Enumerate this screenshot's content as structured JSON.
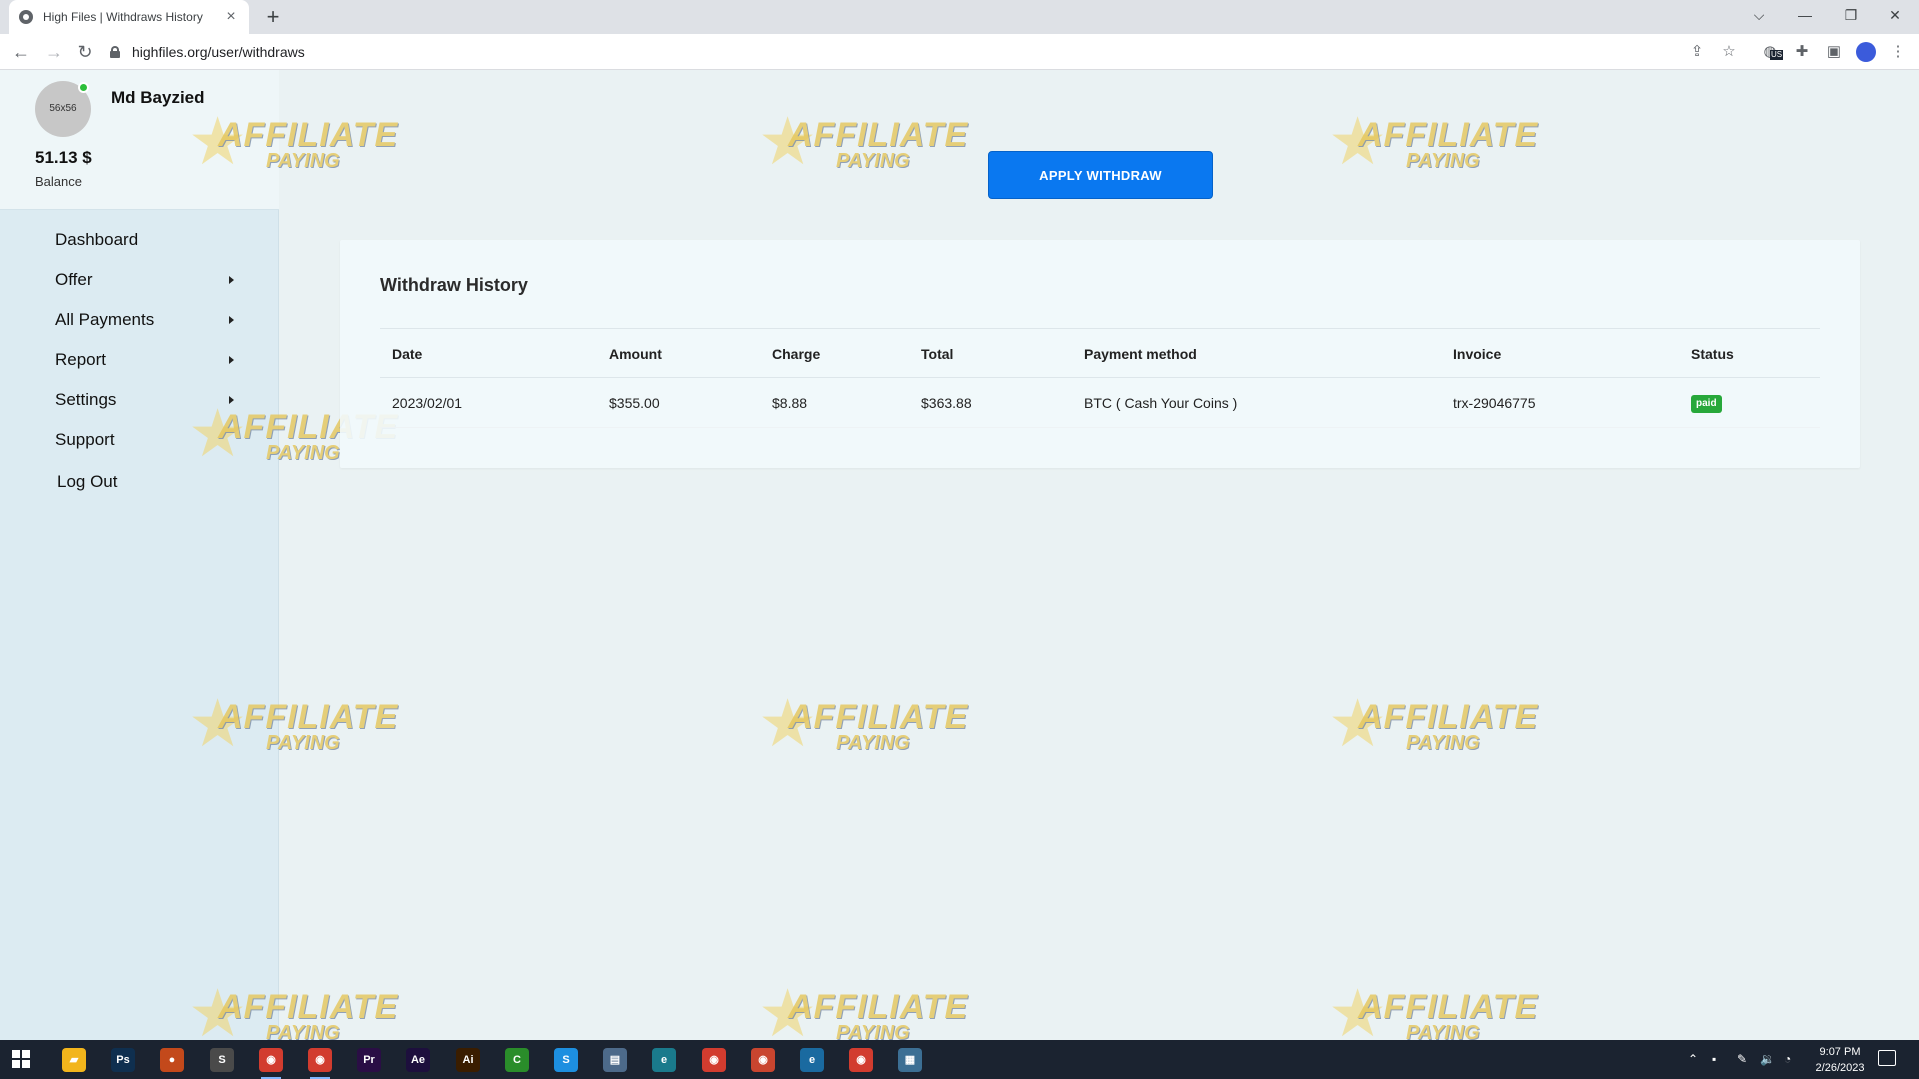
{
  "browser": {
    "tab_title": "High Files | Withdraws History",
    "tab_close": "×",
    "new_tab": "+",
    "url": "highfiles.org/user/withdraws",
    "window_controls": {
      "chevron": "⌵",
      "minimize": "—",
      "restore": "❐",
      "close": "✕"
    },
    "ext_badge": "US"
  },
  "watermark": {
    "text_top": "AFFILIATE",
    "text_bottom": "PAYING"
  },
  "sidebar": {
    "avatar_placeholder": "56x56",
    "user_name": "Md Bayzied",
    "balance_amount": "51.13 $",
    "balance_label": "Balance",
    "menu": [
      {
        "label": "Dashboard",
        "has_submenu": false
      },
      {
        "label": "Offer",
        "has_submenu": true
      },
      {
        "label": "All Payments",
        "has_submenu": true
      },
      {
        "label": "Report",
        "has_submenu": true
      },
      {
        "label": "Settings",
        "has_submenu": true
      },
      {
        "label": "Support",
        "has_submenu": false
      },
      {
        "label": "Log Out",
        "has_submenu": false
      }
    ]
  },
  "main": {
    "apply_button": "APPLY WITHDRAW",
    "card_title": "Withdraw History",
    "table": {
      "headers": {
        "date": "Date",
        "amount": "Amount",
        "charge": "Charge",
        "total": "Total",
        "method": "Payment method",
        "invoice": "Invoice",
        "status": "Status"
      },
      "rows": [
        {
          "date": "2023/02/01",
          "amount": "$355.00",
          "charge": "$8.88",
          "total": "$363.88",
          "method": "BTC ( Cash Your Coins )",
          "invoice": "trx-29046775",
          "status": "paid"
        }
      ]
    }
  },
  "taskbar": {
    "apps": [
      {
        "name": "file-explorer",
        "label": "▰",
        "color": "#f2b51c"
      },
      {
        "name": "photoshop",
        "label": "Ps",
        "color": "#0f2f4f"
      },
      {
        "name": "app-3",
        "label": "●",
        "color": "#c3491b"
      },
      {
        "name": "sublime",
        "label": "S",
        "color": "#4a4a4a"
      },
      {
        "name": "chrome-1",
        "label": "◉",
        "color": "#d23c2f"
      },
      {
        "name": "chrome-2",
        "label": "◉",
        "color": "#d23c2f"
      },
      {
        "name": "premiere",
        "label": "Pr",
        "color": "#2a0e45"
      },
      {
        "name": "after-effects",
        "label": "Ae",
        "color": "#1d0f3d"
      },
      {
        "name": "illustrator",
        "label": "Ai",
        "color": "#3a1d00"
      },
      {
        "name": "camtasia",
        "label": "C",
        "color": "#2a8d2a"
      },
      {
        "name": "skype",
        "label": "S",
        "color": "#1d8fe0"
      },
      {
        "name": "notepad",
        "label": "▤",
        "color": "#4d6a8a"
      },
      {
        "name": "edge",
        "label": "e",
        "color": "#1a7a8c"
      },
      {
        "name": "chrome-3",
        "label": "◉",
        "color": "#d23c2f"
      },
      {
        "name": "chrome-4",
        "label": "◉",
        "color": "#c9452f"
      },
      {
        "name": "edge-2",
        "label": "e",
        "color": "#1a6aa0"
      },
      {
        "name": "chrome-5",
        "label": "◉",
        "color": "#d23c2f"
      },
      {
        "name": "app-18",
        "label": "▦",
        "color": "#3c6f94"
      }
    ],
    "clock_time": "9:07 PM",
    "clock_date": "2/26/2023"
  },
  "colors": {
    "accent": "#0a78f0",
    "status_paid": "#27a83a",
    "sidebar_bg": "#dcebf2"
  }
}
